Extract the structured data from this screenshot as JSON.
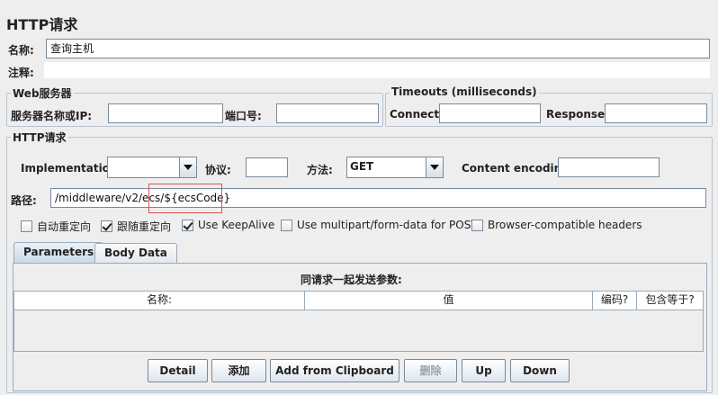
{
  "page": {
    "title": "HTTP请求",
    "name_label": "名称:",
    "name_value": "查询主机",
    "comment_label": "注释:"
  },
  "web_server": {
    "title": "Web服务器",
    "server_label": "服务器名称或IP:",
    "server_value": "",
    "port_label": "端口号:",
    "port_value": ""
  },
  "timeouts": {
    "title": "Timeouts (milliseconds)",
    "connect_label": "Connect:",
    "connect_value": "",
    "response_label": "Response:",
    "response_value": ""
  },
  "http_request": {
    "title": "HTTP请求",
    "implementation_label": "Implementation:",
    "implementation_value": "",
    "protocol_label": "协议:",
    "protocol_value": "",
    "method_label": "方法:",
    "method_value": "GET",
    "encoding_label": "Content encoding:",
    "encoding_value": "",
    "path_label": "路径:",
    "path_value": "/middleware/v2/ecs/${ecsCode}"
  },
  "options": [
    {
      "label": "自动重定向",
      "checked": false
    },
    {
      "label": "跟随重定向",
      "checked": true
    },
    {
      "label": "Use KeepAlive",
      "checked": true
    },
    {
      "label": "Use multipart/form-data for POST",
      "checked": false
    },
    {
      "label": "Browser-compatible headers",
      "checked": false
    }
  ],
  "tabs": [
    {
      "label": "Parameters",
      "active": true
    },
    {
      "label": "Body Data",
      "active": false
    }
  ],
  "params_table": {
    "caption": "同请求一起发送参数:",
    "columns": [
      "名称:",
      "值",
      "编码?",
      "包含等于?"
    ],
    "rows": []
  },
  "buttons": {
    "detail": "Detail",
    "add": "添加",
    "add_clipboard": "Add from Clipboard",
    "delete": "删除",
    "up": "Up",
    "down": "Down"
  },
  "colors": {
    "background": "#eeeeee",
    "border": "#7a8a99",
    "highlight_box": "#d9534f"
  }
}
